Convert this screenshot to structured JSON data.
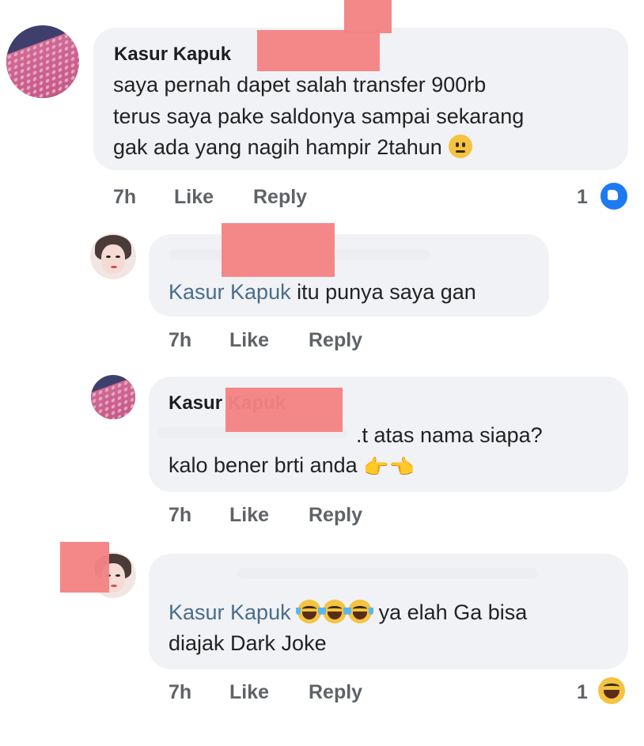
{
  "comments": [
    {
      "author": "Kasur Kapuk",
      "lines": [
        "saya pernah dapet salah transfer 900rb",
        "terus saya pake saldonya sampai sekarang",
        "gak ada yang nagih hampir 2tahun"
      ],
      "emoji": "neutral-face-emoji",
      "time": "7h",
      "like": "Like",
      "reply": "Reply",
      "reaction_count": "1",
      "reaction": "like-reaction-icon"
    },
    {
      "author": "",
      "mention": "Kasur Kapuk",
      "text": "itu punya saya gan",
      "time": "7h",
      "like": "Like",
      "reply": "Reply"
    },
    {
      "author": "Kasur Kapuk",
      "line1": ".t atas nama siapa?",
      "line2": "kalo bener brti anda",
      "emoji": "pointing-hands-emoji",
      "time": "7h",
      "like": "Like",
      "reply": "Reply"
    },
    {
      "author": "",
      "mention": "Kasur Kapuk",
      "text": "ya elah Ga bisa",
      "line2": "diajak Dark Joke",
      "emoji": "laughing-tears-emoji",
      "time": "7h",
      "like": "Like",
      "reply": "Reply",
      "reaction_count": "1",
      "reaction": "haha-reaction-icon"
    }
  ],
  "colors": {
    "bubble": "#f0f2f5",
    "mention": "#4a6d8a",
    "redaction": "#f48383",
    "like_blue": "#1d7bf0"
  }
}
